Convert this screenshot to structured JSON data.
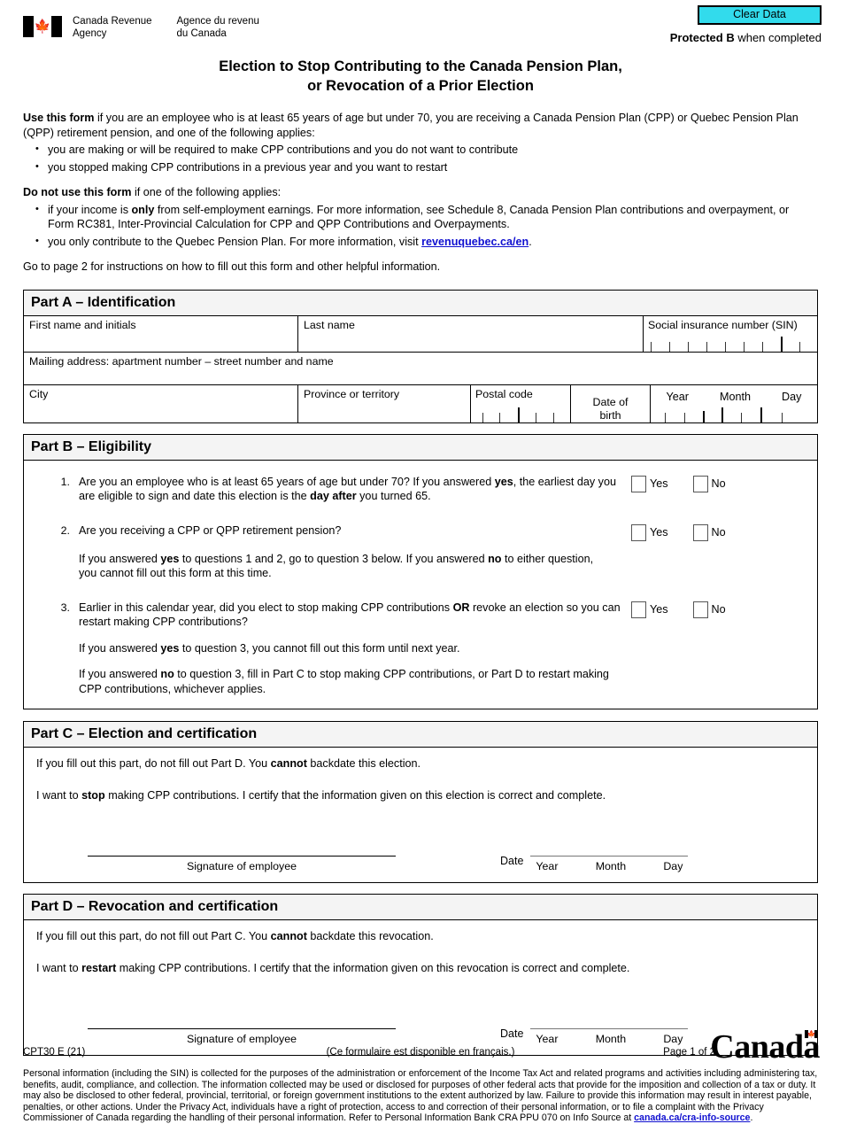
{
  "header": {
    "clear_data_label": "Clear Data",
    "protected_bold": "Protected B",
    "protected_rest": " when completed",
    "agency_en_line1": "Canada Revenue",
    "agency_en_line2": "Agency",
    "agency_fr_line1": "Agence du revenu",
    "agency_fr_line2": "du Canada",
    "flag_icon": "canada-flag-icon"
  },
  "title": {
    "line1": "Election to Stop Contributing to the Canada Pension Plan,",
    "line2": "or Revocation of a Prior Election"
  },
  "intro": {
    "use_bold": "Use this form",
    "use_rest": " if you are an employee who is at least 65 years of age but under 70, you are receiving a Canada Pension Plan (CPP) or Quebec Pension Plan (QPP) retirement pension, and one of the following applies:",
    "use_bullets": [
      "you are making or will be required to make CPP contributions and you do not want to contribute",
      "you stopped making CPP contributions in a previous year and you want to restart"
    ],
    "donot_bold": "Do not use this form",
    "donot_rest": " if one of the following applies:",
    "donot_bullet_1_a": "if your income is ",
    "donot_bullet_1_bold": "only",
    "donot_bullet_1_b": " from self-employment earnings. For more information, see Schedule 8, Canada Pension Plan contributions and overpayment, or Form RC381, Inter-Provincial Calculation for CPP and QPP Contributions and Overpayments.",
    "donot_bullet_2_a": "you only contribute to the Quebec Pension Plan. For more information, visit ",
    "donot_bullet_2_link": "revenuquebec.ca/en",
    "donot_bullet_2_b": ".",
    "goto_page2": "Go to page 2 for instructions on how to fill out this form and other helpful information."
  },
  "part_a": {
    "heading": "Part A – Identification",
    "first_name_label": "First name and initials",
    "last_name_label": "Last name",
    "sin_label": "Social insurance number (SIN)",
    "mailing_label": "Mailing address: apartment number – street number and name",
    "city_label": "City",
    "province_label": "Province or territory",
    "postal_label": "Postal code",
    "dob_label_line1": "Date  of",
    "dob_label_line2": "birth",
    "date_year": "Year",
    "date_month": "Month",
    "date_day": "Day"
  },
  "part_b": {
    "heading": "Part B – Eligibility",
    "yes_label": "Yes",
    "no_label": "No",
    "questions": [
      {
        "number": "1.",
        "text_a": "Are you an employee who is at least 65 years of age but under 70? If you answered ",
        "bold_1": "yes",
        "text_b": ", the earliest day you are eligible to sign and date this election is the ",
        "bold_2": "day after",
        "text_c": " you turned 65."
      },
      {
        "number": "2.",
        "text_a": "Are you receiving a CPP or QPP retirement pension?",
        "bold_1": "",
        "text_b": "",
        "bold_2": "",
        "text_c": ""
      },
      {
        "number": "3.",
        "text_a": "Earlier in this calendar year, did you elect to stop making CPP contributions ",
        "bold_1": "OR",
        "text_b": " revoke an election so you can restart making CPP contributions?",
        "bold_2": "",
        "text_c": ""
      }
    ],
    "note_q2_a": "If you answered ",
    "note_q2_bold1": "yes",
    "note_q2_b": " to questions 1 and 2, go to question 3 below. If you answered ",
    "note_q2_bold2": "no",
    "note_q2_c": " to either question, you cannot fill out this form at this time.",
    "note_q3a_a": "If you answered ",
    "note_q3a_bold": "yes",
    "note_q3a_b": " to question 3, you cannot fill out this form until next year.",
    "note_q3b_a": "If you answered ",
    "note_q3b_bold": "no",
    "note_q3b_b": " to question 3, fill in Part C to stop making CPP contributions, or Part D to restart making CPP contributions, whichever applies."
  },
  "part_c": {
    "heading": "Part C – Election and certification",
    "line1_a": "If you fill out this part, do not fill out Part D. You ",
    "line1_bold": "cannot",
    "line1_b": " backdate this election.",
    "line2_a": "I want to ",
    "line2_bold": "stop",
    "line2_b": " making CPP contributions. I certify that the information given on this election is correct and complete.",
    "signature_caption": "Signature of employee",
    "date_word": "Date",
    "date_year": "Year",
    "date_month": "Month",
    "date_day": "Day"
  },
  "part_d": {
    "heading": "Part D – Revocation and certification",
    "line1_a": "If you fill out this part, do not fill out Part C. You ",
    "line1_bold": "cannot",
    "line1_b": " backdate this revocation.",
    "line2_a": "I want to ",
    "line2_bold": "restart",
    "line2_b": " making CPP contributions. I certify that the information given on this revocation is correct and complete.",
    "signature_caption": "Signature of employee",
    "date_word": "Date",
    "date_year": "Year",
    "date_month": "Month",
    "date_day": "Day"
  },
  "privacy": {
    "text": "Personal information (including the SIN) is collected for the purposes of the administration or enforcement of the Income Tax Act and related programs and activities including administering tax, benefits, audit, compliance, and collection. The information collected may be used or disclosed for purposes of other federal acts that provide for the imposition and collection of a tax or duty. It may also be disclosed to other federal, provincial, territorial, or foreign government institutions to the extent authorized by law. Failure to provide this information may result in interest payable, penalties, or other actions. Under the Privacy Act, individuals have a right of protection, access to and correction of their personal information, or to file a complaint with the Privacy Commissioner of Canada regarding the handling of their personal information. Refer to Personal Information Bank CRA PPU 070 on Info Source at ",
    "link": "canada.ca/cra-info-source",
    "period": "."
  },
  "footer": {
    "form_code": "CPT30 E (21)",
    "french_note": "(Ce formulaire est disponible en français.)",
    "page_number": "Page 1 of 2",
    "wordmark": "Canada",
    "wordmark_flag_icon": "canada-flag-icon"
  },
  "colors": {
    "clear_data_bg": "#32DBEC",
    "link": "#1010D0",
    "part_head_bg": "#F4F4F4"
  }
}
